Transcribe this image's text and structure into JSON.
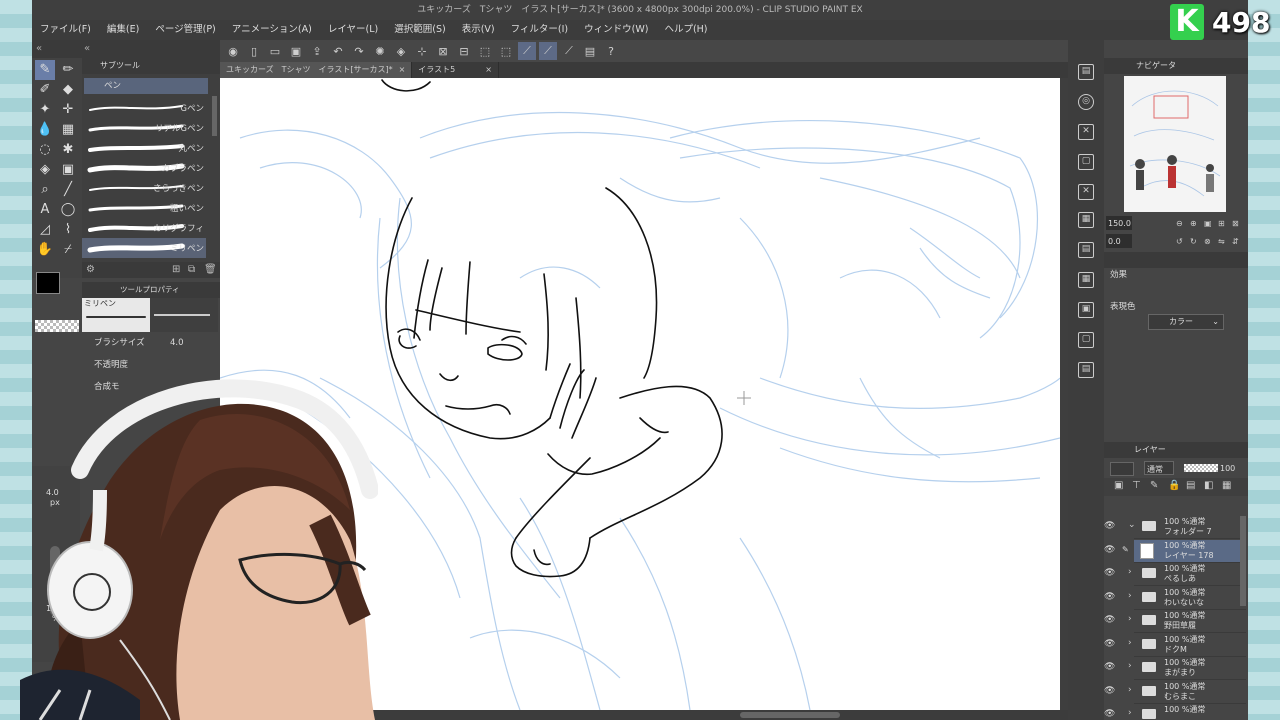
{
  "window": {
    "title": "ユキッカーズ　Tシャツ　イラスト[サーカス]* (3600 x 4800px 300dpi 200.0%)  - CLIP STUDIO PAINT EX"
  },
  "badge": {
    "letter": "K",
    "count": "498"
  },
  "menu": [
    "ファイル(F)",
    "編集(E)",
    "ページ管理(P)",
    "アニメーション(A)",
    "レイヤー(L)",
    "選択範囲(S)",
    "表示(V)",
    "フィルター(I)",
    "ウィンドウ(W)",
    "ヘルプ(H)"
  ],
  "tabs": [
    {
      "label": "ユキッカーズ　Tシャツ　イラスト[サーカス]*",
      "close": "×"
    },
    {
      "label": "イラスト5",
      "close": "×"
    }
  ],
  "subtool": {
    "header": "サブツール",
    "group": "ペン",
    "brushes": [
      "Gペン",
      "リアルGペン",
      "丸ペン",
      "カブラペン",
      "さらっきペン",
      "粗いペン",
      "カリグラフィ",
      "ミリペン"
    ],
    "selected_index": 7
  },
  "tool_property": {
    "header": "ツールプロパティ",
    "brush_name": "ミリペン",
    "brush_size_label": "ブラシサイズ",
    "brush_size_value": "4.0",
    "opacity_label": "不透明度",
    "blend_label": "合成モ"
  },
  "size_indicator": {
    "value": "4.0",
    "unit": "px",
    "pct": "100",
    "pct_unit": "%"
  },
  "navigator": {
    "header": "ナビゲータ",
    "zoom": "150.0",
    "rotate": "0.0"
  },
  "effect": {
    "header": "効果",
    "color_label": "表現色",
    "color_value": "カラー"
  },
  "layers_panel": {
    "header": "レイヤー",
    "blend": "通常",
    "opacity": "100",
    "layers": [
      {
        "line1": "100 %通常",
        "line2": "フォルダー 7",
        "type": "folder",
        "expanded": true
      },
      {
        "line1": "100 %通常",
        "line2": "レイヤー 178",
        "type": "layer",
        "selected": true
      },
      {
        "line1": "100 %通常",
        "line2": "ぺるしあ",
        "type": "folder"
      },
      {
        "line1": "100 %通常",
        "line2": "わいないな",
        "type": "folder"
      },
      {
        "line1": "100 %通常",
        "line2": "野田草履",
        "type": "folder"
      },
      {
        "line1": "100 %通常",
        "line2": "ドクM",
        "type": "folder"
      },
      {
        "line1": "100 %通常",
        "line2": "まがまり",
        "type": "folder"
      },
      {
        "line1": "100 %通常",
        "line2": "むらまこ",
        "type": "folder"
      },
      {
        "line1": "100 %通常",
        "line2": "",
        "type": "folder"
      }
    ]
  },
  "colors": {
    "accent": "#5a6a86",
    "sketch": "#9fc2e6",
    "badge_green": "#34d04e"
  }
}
